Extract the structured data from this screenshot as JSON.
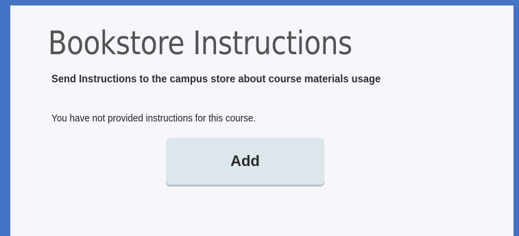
{
  "page": {
    "title": "Bookstore Instructions",
    "subtitle": "Send Instructions to the campus store about course materials usage",
    "message": "You have not provided instructions for this course.",
    "add_label": "Add"
  },
  "colors": {
    "frame_background": "#4472c4",
    "panel_background": "#f6f6fb",
    "button_background": "#dde6ea",
    "title_text": "#535353"
  }
}
